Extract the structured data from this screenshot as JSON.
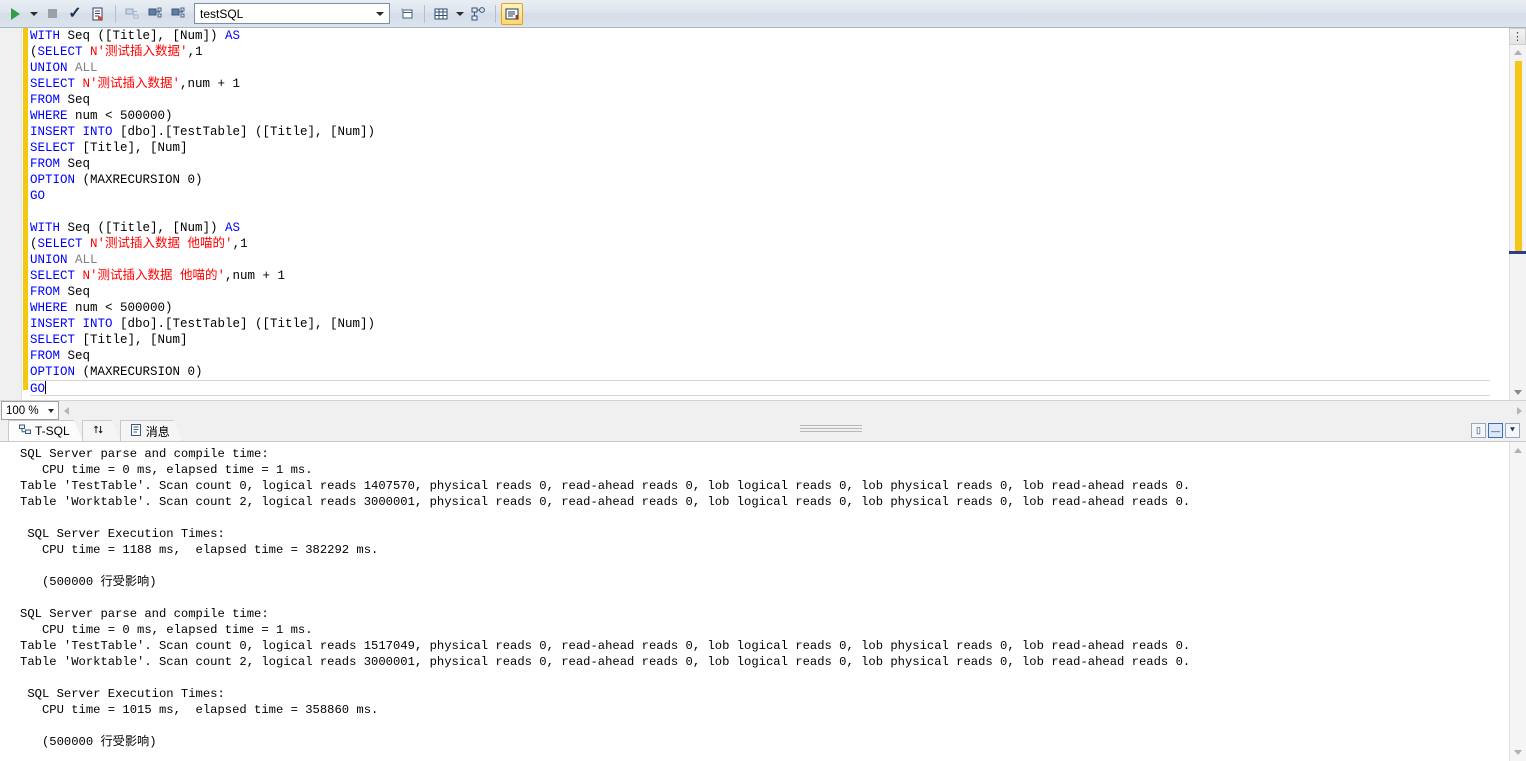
{
  "toolbar": {
    "execute_label": "Execute",
    "execute_dropdown_label": "Execute options",
    "stop_label": "Cancel Executing Query",
    "parse_label": "Parse",
    "debug_label": "Debug",
    "display_estimated_plan_label": "Display Estimated Execution Plan",
    "include_actual_plan_label": "Include Actual Execution Plan",
    "include_live_stats_label": "Include Live Query Statistics",
    "database_value": "testSQL",
    "database_placeholder": "Available Databases",
    "specify_values_label": "Specify Values for Template Parameters",
    "results_to_grid_label": "Results to Grid",
    "results_dropdown_label": "Results to options",
    "design_query_label": "Design Query in Editor",
    "results_to_text_label": "Results to Text"
  },
  "editor": {
    "lines": [
      {
        "id": "l1",
        "segs": [
          {
            "t": "WITH",
            "c": "kw"
          },
          {
            "t": " Seq ([Title], [Num]) ",
            "c": "pl"
          },
          {
            "t": "AS",
            "c": "kw"
          }
        ]
      },
      {
        "id": "l2",
        "segs": [
          {
            "t": "(",
            "c": "pl"
          },
          {
            "t": "SELECT",
            "c": "kw"
          },
          {
            "t": " ",
            "c": "pl"
          },
          {
            "t": "N'测试插入数据'",
            "c": "str"
          },
          {
            "t": ",1",
            "c": "pl"
          }
        ]
      },
      {
        "id": "l3",
        "segs": [
          {
            "t": "UNION",
            "c": "kw"
          },
          {
            "t": " ",
            "c": "pl"
          },
          {
            "t": "ALL",
            "c": "gray"
          }
        ]
      },
      {
        "id": "l4",
        "segs": [
          {
            "t": "SELECT",
            "c": "kw"
          },
          {
            "t": " ",
            "c": "pl"
          },
          {
            "t": "N'测试插入数据'",
            "c": "str"
          },
          {
            "t": ",num + 1",
            "c": "pl"
          }
        ]
      },
      {
        "id": "l5",
        "segs": [
          {
            "t": "FROM",
            "c": "kw"
          },
          {
            "t": " Seq",
            "c": "pl"
          }
        ]
      },
      {
        "id": "l6",
        "segs": [
          {
            "t": "WHERE",
            "c": "kw"
          },
          {
            "t": " num < 500000)",
            "c": "pl"
          }
        ]
      },
      {
        "id": "l7",
        "segs": [
          {
            "t": "INSERT INTO",
            "c": "kw"
          },
          {
            "t": " [dbo].[TestTable] ([Title], [Num])",
            "c": "pl"
          }
        ]
      },
      {
        "id": "l8",
        "segs": [
          {
            "t": "SELECT",
            "c": "kw"
          },
          {
            "t": " [Title], [Num]",
            "c": "pl"
          }
        ]
      },
      {
        "id": "l9",
        "segs": [
          {
            "t": "FROM",
            "c": "kw"
          },
          {
            "t": " Seq",
            "c": "pl"
          }
        ]
      },
      {
        "id": "l10",
        "segs": [
          {
            "t": "OPTION",
            "c": "kw"
          },
          {
            "t": " (MAXRECURSION 0)",
            "c": "pl"
          }
        ]
      },
      {
        "id": "l11",
        "segs": [
          {
            "t": "GO",
            "c": "kw"
          }
        ]
      },
      {
        "id": "l12",
        "segs": []
      },
      {
        "id": "l13",
        "segs": [
          {
            "t": "WITH",
            "c": "kw"
          },
          {
            "t": " Seq ([Title], [Num]) ",
            "c": "pl"
          },
          {
            "t": "AS",
            "c": "kw"
          }
        ]
      },
      {
        "id": "l14",
        "segs": [
          {
            "t": "(",
            "c": "pl"
          },
          {
            "t": "SELECT",
            "c": "kw"
          },
          {
            "t": " ",
            "c": "pl"
          },
          {
            "t": "N'测试插入数据 他喵的'",
            "c": "str"
          },
          {
            "t": ",1",
            "c": "pl"
          }
        ]
      },
      {
        "id": "l15",
        "segs": [
          {
            "t": "UNION",
            "c": "kw"
          },
          {
            "t": " ",
            "c": "pl"
          },
          {
            "t": "ALL",
            "c": "gray"
          }
        ]
      },
      {
        "id": "l16",
        "segs": [
          {
            "t": "SELECT",
            "c": "kw"
          },
          {
            "t": " ",
            "c": "pl"
          },
          {
            "t": "N'测试插入数据 他喵的'",
            "c": "str"
          },
          {
            "t": ",num + 1",
            "c": "pl"
          }
        ]
      },
      {
        "id": "l17",
        "segs": [
          {
            "t": "FROM",
            "c": "kw"
          },
          {
            "t": " Seq",
            "c": "pl"
          }
        ]
      },
      {
        "id": "l18",
        "segs": [
          {
            "t": "WHERE",
            "c": "kw"
          },
          {
            "t": " num < 500000)",
            "c": "pl"
          }
        ]
      },
      {
        "id": "l19",
        "segs": [
          {
            "t": "INSERT INTO",
            "c": "kw"
          },
          {
            "t": " [dbo].[TestTable] ([Title], [Num])",
            "c": "pl"
          }
        ]
      },
      {
        "id": "l20",
        "segs": [
          {
            "t": "SELECT",
            "c": "kw"
          },
          {
            "t": " [Title], [Num]",
            "c": "pl"
          }
        ]
      },
      {
        "id": "l21",
        "segs": [
          {
            "t": "FROM",
            "c": "kw"
          },
          {
            "t": " Seq",
            "c": "pl"
          }
        ]
      },
      {
        "id": "l22",
        "segs": [
          {
            "t": "OPTION",
            "c": "kw"
          },
          {
            "t": " (MAXRECURSION 0)",
            "c": "pl"
          }
        ]
      },
      {
        "id": "l23",
        "segs": [
          {
            "t": "GO",
            "c": "kw"
          }
        ],
        "current": true,
        "caret": true
      }
    ],
    "colors": {
      "keyword": "#0000ff",
      "string": "#ff0000",
      "gray_keyword": "#808080",
      "plain": "#000000",
      "change_bar": "#f2c811"
    }
  },
  "status_strip": {
    "zoom_value": "100 %"
  },
  "results": {
    "tabs": [
      {
        "id": "tsql",
        "icon": "plan-icon",
        "label": "T-SQL",
        "selected": true
      },
      {
        "id": "sort",
        "icon": "sort-arrows-icon",
        "label": "",
        "selected": false
      },
      {
        "id": "messages",
        "icon": "message-page-icon",
        "label": "消息",
        "selected": false
      }
    ],
    "window_buttons": [
      {
        "id": "restore",
        "glyph": "▯",
        "selected": false
      },
      {
        "id": "minimize",
        "glyph": "—",
        "selected": true
      },
      {
        "id": "close-down",
        "glyph": "⯆",
        "selected": false
      }
    ],
    "message_lines": [
      "SQL Server parse and compile time:",
      "   CPU time = 0 ms, elapsed time = 1 ms.",
      "Table 'TestTable'. Scan count 0, logical reads 1407570, physical reads 0, read-ahead reads 0, lob logical reads 0, lob physical reads 0, lob read-ahead reads 0.",
      "Table 'Worktable'. Scan count 2, logical reads 3000001, physical reads 0, read-ahead reads 0, lob logical reads 0, lob physical reads 0, lob read-ahead reads 0.",
      "",
      " SQL Server Execution Times:",
      "   CPU time = 1188 ms,  elapsed time = 382292 ms.",
      "",
      "   (500000 行受影响)",
      "",
      "SQL Server parse and compile time:",
      "   CPU time = 0 ms, elapsed time = 1 ms.",
      "Table 'TestTable'. Scan count 0, logical reads 1517049, physical reads 0, read-ahead reads 0, lob logical reads 0, lob physical reads 0, lob read-ahead reads 0.",
      "Table 'Worktable'. Scan count 2, logical reads 3000001, physical reads 0, read-ahead reads 0, lob logical reads 0, lob physical reads 0, lob read-ahead reads 0.",
      "",
      " SQL Server Execution Times:",
      "   CPU time = 1015 ms,  elapsed time = 358860 ms.",
      "",
      "   (500000 行受影响)"
    ]
  }
}
